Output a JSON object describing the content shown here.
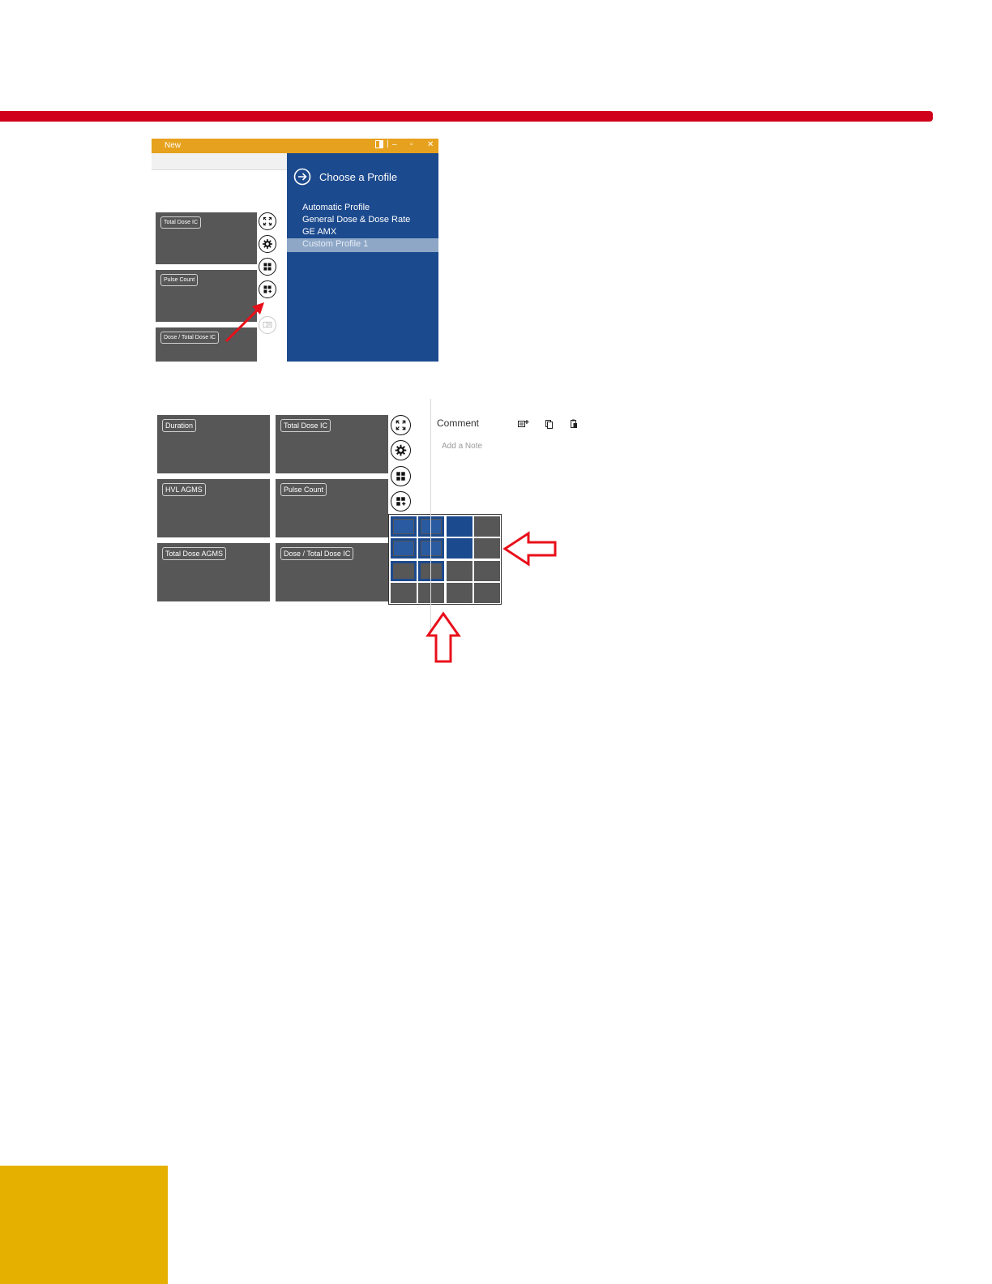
{
  "colors": {
    "brand_red": "#d0021b",
    "titlebar_orange": "#e6a11e",
    "profile_blue": "#1c4a8e",
    "tile_gray": "#575757",
    "grid_selected_blue": "#1c4a8e",
    "footer_yellow": "#e6b000"
  },
  "window": {
    "title": "New",
    "controls": [
      "panel-icon",
      "minimize-icon",
      "maximize-icon",
      "close-icon"
    ]
  },
  "top_tiles": [
    "Total Dose IC",
    "Pulse Count",
    "Dose / Total Dose IC"
  ],
  "side_buttons": [
    "fullscreen-icon",
    "settings-gear-icon",
    "layout-grid-icon",
    "add-tile-grid-icon",
    "report-icon"
  ],
  "profile_panel": {
    "title": "Choose a Profile",
    "items": [
      "Automatic Profile",
      "General Dose & Dose Rate",
      "GE AMX",
      "Custom Profile 1"
    ],
    "selected_index": 3
  },
  "bottom_tiles": [
    "Duration",
    "Total Dose IC",
    "HVL AGMS",
    "Pulse Count",
    "Total Dose AGMS",
    "Dose / Total Dose IC"
  ],
  "layout_grid": {
    "rows": 4,
    "columns": 4,
    "selected_columns": 3,
    "selected_rows": 2
  },
  "comment": {
    "label": "Comment",
    "placeholder": "Add a Note",
    "icons": [
      "add-note-icon",
      "copy-icon",
      "paste-icon"
    ]
  },
  "annotations": [
    "red-arrow-pointer",
    "red-hollow-arrow-left",
    "red-hollow-arrow-up"
  ]
}
